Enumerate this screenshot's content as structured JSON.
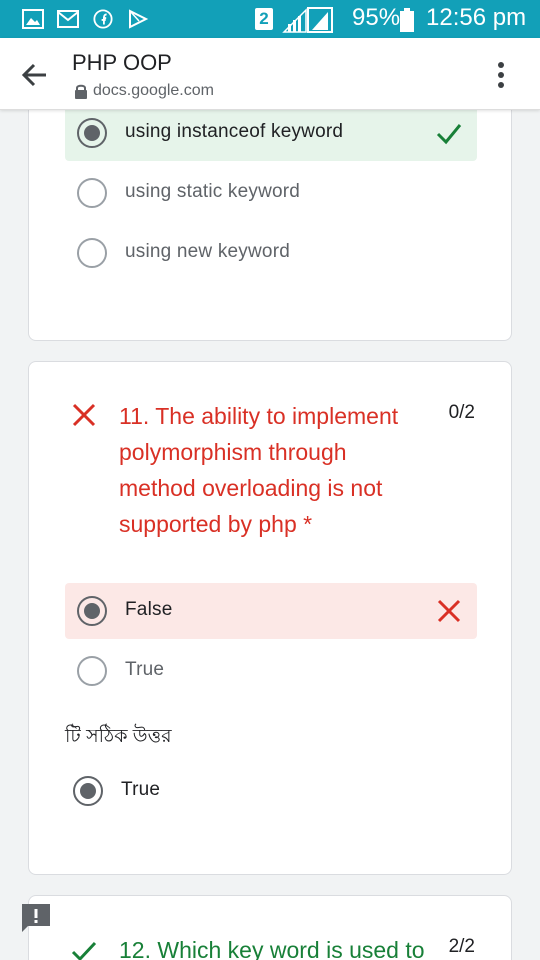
{
  "status_bar": {
    "sim_slot": "2",
    "battery": "95%",
    "time": "12:56 pm",
    "icons": [
      "gallery-icon",
      "mail-icon",
      "facebook-icon",
      "play-store-icon",
      "signal-icon",
      "battery-icon"
    ]
  },
  "app_bar": {
    "title": "PHP OOP",
    "url": "docs.google.com"
  },
  "question_10_options": [
    {
      "label": "using instanceof keyword",
      "selected": true,
      "result": "correct"
    },
    {
      "label": "using static keyword",
      "selected": false
    },
    {
      "label": "using new keyword",
      "selected": false
    }
  ],
  "question_11": {
    "text": "11. The ability to implement polymorphism through method overloading is not supported by php *",
    "score": "0/2",
    "options": [
      {
        "label": "False",
        "selected": true,
        "result": "wrong"
      },
      {
        "label": "True",
        "selected": false
      }
    ],
    "correct_answer_label": "টি সঠিক উত্তর",
    "correct_answer": "True"
  },
  "question_12": {
    "text": "12. Which key word is used to",
    "score": "2/2"
  },
  "colors": {
    "status_bar": "#12a0b8",
    "correct_bg": "#e6f4ea",
    "wrong_bg": "#fce8e6",
    "correct_mark": "#188038",
    "wrong_mark": "#d93025"
  }
}
